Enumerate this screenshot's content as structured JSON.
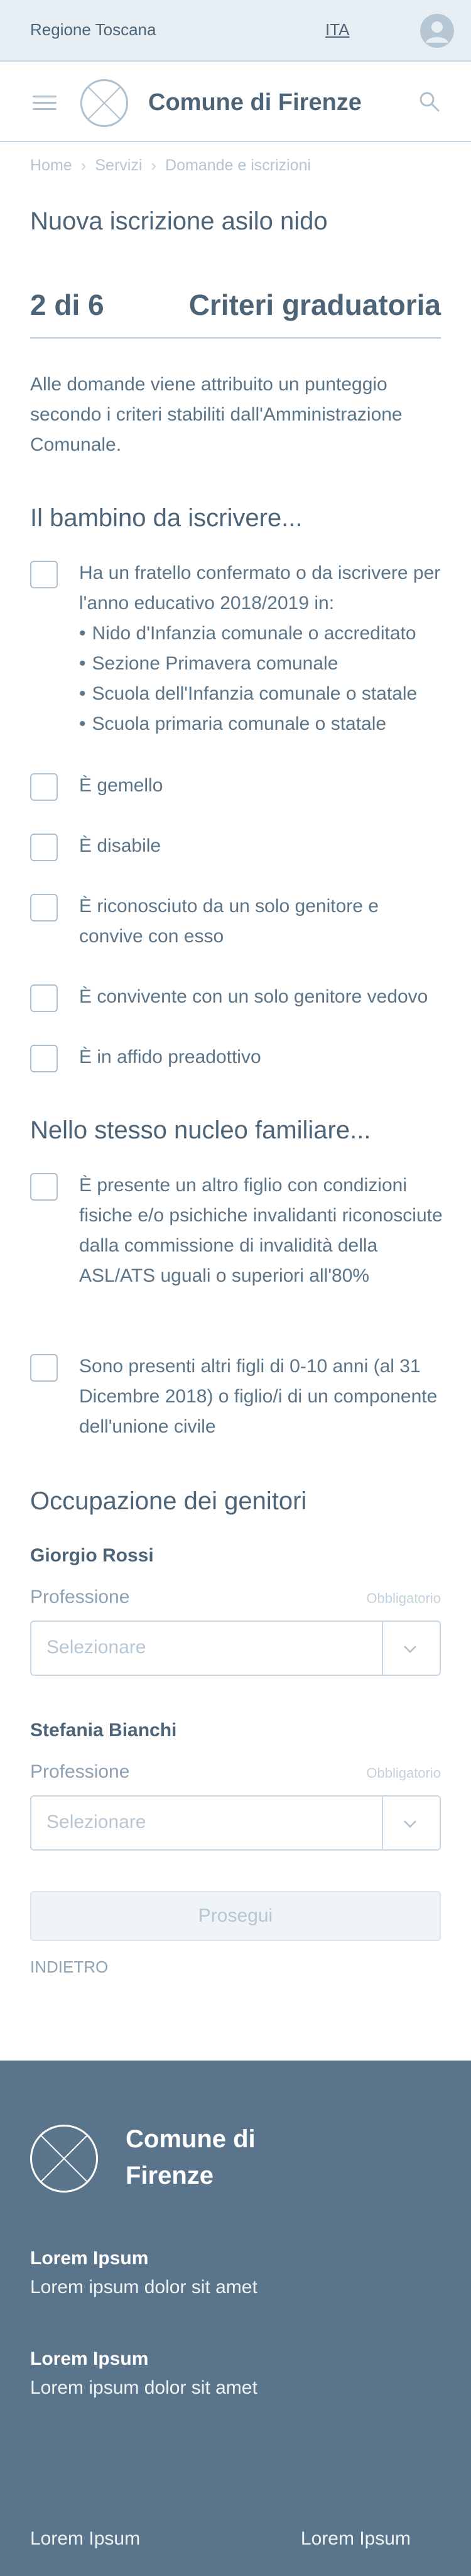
{
  "topbar": {
    "region": "Regione Toscana",
    "language": "ITA"
  },
  "header": {
    "title": "Comune di Firenze"
  },
  "breadcrumb": [
    "Home",
    "Servizi",
    "Domande e iscrizioni"
  ],
  "page_title": "Nuova iscrizione asilo nido",
  "step": {
    "number": "2 di 6",
    "name": "Criteri graduatoria"
  },
  "intro": "Alle domande viene attribuito un punteggio secondo i criteri stabiliti dall'Amministrazione Comunale.",
  "section_child": {
    "title": "Il bambino da iscrivere...",
    "options": [
      {
        "label": "Ha un fratello confermato o da iscrivere per l'anno educativo 2018/2019 in:",
        "sub": [
          "Nido d'Infanzia comunale o accreditato",
          "Sezione Primavera comunale",
          "Scuola dell'Infanzia comunale o statale",
          "Scuola primaria comunale o statale"
        ]
      },
      {
        "label": "È gemello"
      },
      {
        "label": "È disabile"
      },
      {
        "label": "È riconosciuto da un solo genitore e convive con esso"
      },
      {
        "label": "È convivente con un solo genitore vedovo"
      },
      {
        "label": "È in affido preadottivo"
      }
    ]
  },
  "section_family": {
    "title": "Nello stesso nucleo familiare...",
    "options": [
      {
        "label": "È presente un altro figlio con condizioni fisiche e/o psichiche invalidanti riconosciute dalla commissione di invalidità della ASL/ATS uguali o superiori all'80%"
      },
      {
        "label": "Sono presenti altri figli di 0-10 anni (al 31 Dicembre 2018) o figlio/i di un componente dell'unione civile"
      }
    ]
  },
  "section_parents": {
    "title": "Occupazione dei genitori",
    "parents": [
      {
        "name": "Giorgio Rossi",
        "field_label": "Professione",
        "required": "Obbligatorio",
        "placeholder": "Selezionare"
      },
      {
        "name": "Stefania Bianchi",
        "field_label": "Professione",
        "required": "Obbligatorio",
        "placeholder": "Selezionare"
      }
    ]
  },
  "actions": {
    "next": "Prosegui",
    "back": "INDIETRO"
  },
  "footer": {
    "title": "Comune di Firenze",
    "blocks": [
      {
        "title": "Lorem Ipsum",
        "text": "Lorem ipsum dolor sit amet"
      },
      {
        "title": "Lorem Ipsum",
        "text": "Lorem ipsum dolor sit amet"
      }
    ],
    "links": [
      "Lorem Ipsum",
      "Lorem Ipsum"
    ]
  }
}
